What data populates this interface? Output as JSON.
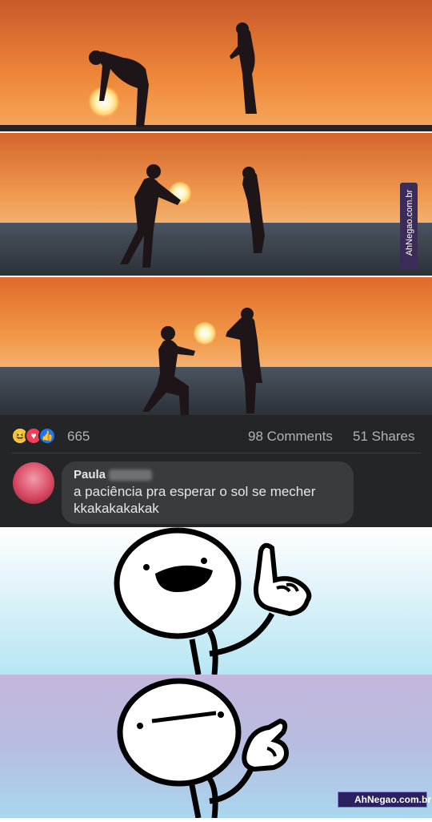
{
  "photos": {
    "panel_count": 3,
    "colors": {
      "sky_top": "#e8793a",
      "sky_bottom": "#f5a35a",
      "sea": "#3c4650",
      "sun": "#fff4c4",
      "silhouette": "#1c1416"
    }
  },
  "watermark": {
    "side_text": "AhNegao.com.br",
    "bottom_text": "AhNegao.com.br"
  },
  "post": {
    "reaction_icons": [
      "laugh-emoji-icon",
      "heart-icon",
      "like-icon"
    ],
    "reactions_count": "665",
    "comments": "98 Comments",
    "shares": "51 Shares"
  },
  "comment": {
    "author": "Paula",
    "text_line1": "a paciência pra esperar o sol se mecher",
    "text_line2": "kkakakakakak"
  },
  "meme": {
    "panel1_face": "open-mouth",
    "panel2_face": "flat-mouth",
    "colors": {
      "bg1": "#b6e6f3",
      "bg2": "#c5b6dc"
    }
  }
}
